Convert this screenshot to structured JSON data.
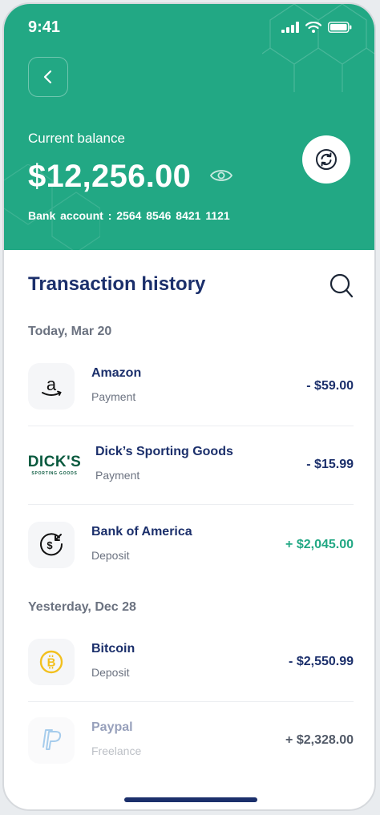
{
  "status_bar": {
    "time": "9:41"
  },
  "header": {
    "current_balance_label": "Current balance",
    "balance": "$12,256.00",
    "bank_account": "Bank account : 2564  8546  8421  1121",
    "accent_color": "#22a884"
  },
  "history": {
    "title": "Transaction history",
    "groups": [
      {
        "date": "Today, Mar 20",
        "items": [
          {
            "name": "Amazon",
            "type": "Payment",
            "amount": "- $59.00",
            "icon": "amazon-logo"
          },
          {
            "name": "Dick’s Sporting Goods",
            "type": "Payment",
            "amount": "- $15.99",
            "icon": "dicks-logo",
            "logo_text": "DICK'S",
            "logo_sub": "SPORTING GOODS"
          },
          {
            "name": "Bank of America",
            "type": "Deposit",
            "amount": "+ $2,045.00",
            "icon": "deposit-icon"
          }
        ]
      },
      {
        "date": "Yesterday, Dec 28",
        "items": [
          {
            "name": "Bitcoin",
            "type": "Deposit",
            "amount": "- $2,550.99",
            "icon": "bitcoin-icon"
          },
          {
            "name": "Paypal",
            "type": "Freelance",
            "amount": "+ $2,328.00",
            "icon": "paypal-icon"
          }
        ]
      }
    ]
  }
}
